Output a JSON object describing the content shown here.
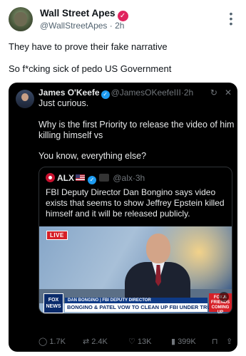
{
  "post": {
    "author_name": "Wall Street Apes",
    "handle": "@WallStreetApes",
    "time": "2h",
    "separator": "·",
    "text_line1": "They have to prove their fake narrative",
    "text_line2": "So f*cking sick of pedo US Government"
  },
  "embed": {
    "author_name": "James O'Keefe",
    "handle": "@JamesOKeefeIII",
    "time": "2h",
    "line1": "Just curious.",
    "line2": "Why is the first Priority to release the video of him",
    "line3": "killing himself vs",
    "line4": "You know, everything else?",
    "quote": {
      "author_name": "ALX",
      "handle": "@alx",
      "time": "3h",
      "line1": "FBI Deputy Director Dan Bongino says video",
      "line2": "exists that seems to show Jeffrey Epstein killed",
      "line3": "himself and it will be released publicly."
    },
    "video": {
      "live_label": "LIVE",
      "network_line1": "FOX",
      "network_line2": "NEWS",
      "lower_third_name": "DAN BONGINO | FBI DEPUTY DIRECTOR",
      "lower_third_headline": "BONGINO & PATEL VOW TO CLEAN UP FBI UNDER TRUMP",
      "promo_line1": "FOX &",
      "promo_line2": "FRIENDS",
      "promo_line3": "COMING UP"
    },
    "actions": {
      "replies": "1.7K",
      "reposts": "2.4K",
      "likes": "13K",
      "views": "399K"
    }
  },
  "colors": {
    "verified_badge": "#e0245e",
    "blue_check": "#1d9bf0",
    "embed_bg": "#000000",
    "muted_text": "#71767b"
  }
}
